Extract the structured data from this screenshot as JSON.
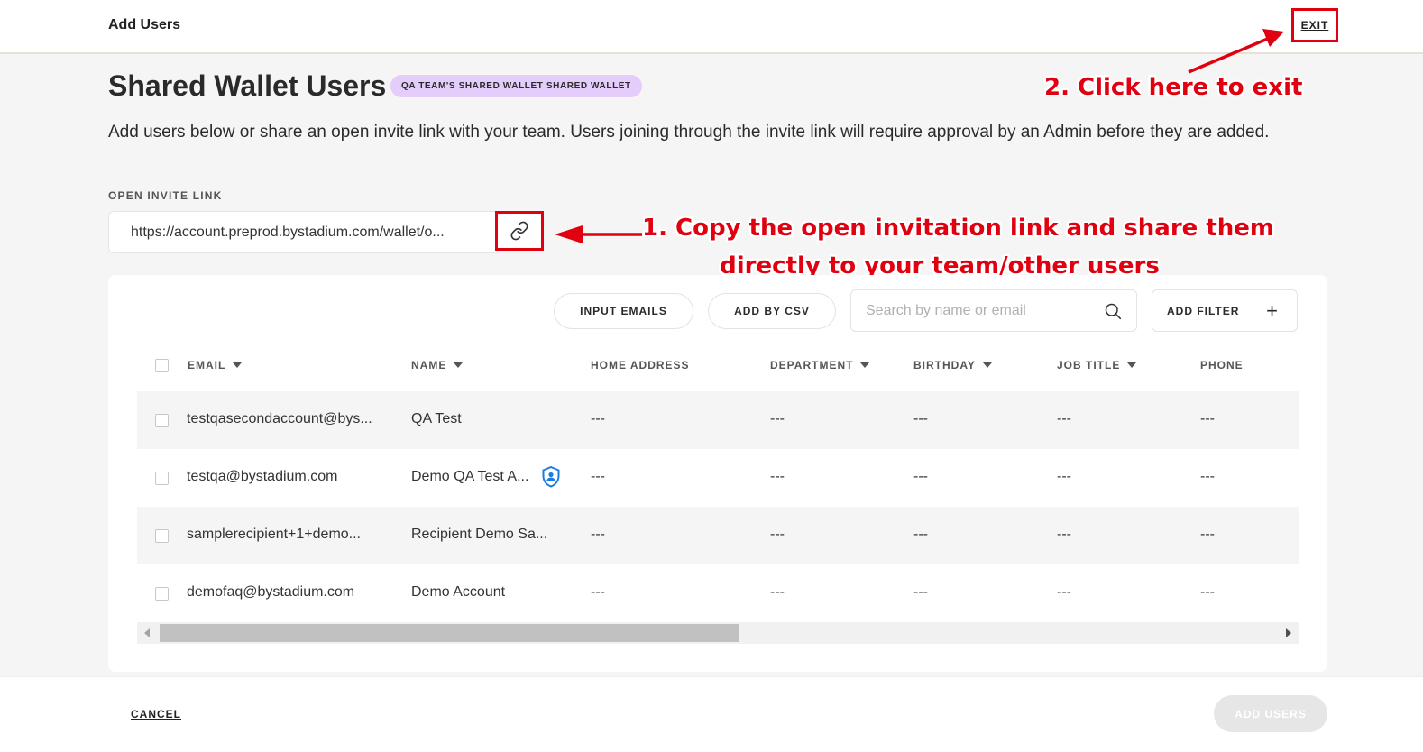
{
  "header": {
    "title": "Add Users",
    "exit_label": "EXIT"
  },
  "page": {
    "title": "Shared Wallet Users",
    "wallet_badge": "QA TEAM'S SHARED WALLET SHARED WALLET",
    "description": "Add users below or share an open invite link with your team. Users joining through the invite link will require approval by an Admin before they are added."
  },
  "invite": {
    "label": "OPEN INVITE LINK",
    "url": "https://account.preprod.bystadium.com/wallet/o..."
  },
  "annotations": {
    "step1_line1": "1. Copy the open invitation link and share them",
    "step1_line2": "directly to your team/other users",
    "step2": "2. Click here to exit",
    "accent_color": "#e00010"
  },
  "toolbar": {
    "input_emails": "INPUT EMAILS",
    "add_by_csv": "ADD BY CSV",
    "search_placeholder": "Search by name or email",
    "add_filter": "ADD FILTER"
  },
  "table": {
    "columns": [
      "EMAIL",
      "NAME",
      "HOME ADDRESS",
      "DEPARTMENT",
      "BIRTHDAY",
      "JOB TITLE",
      "PHONE"
    ],
    "rows": [
      {
        "email": "testqasecondaccount@bys...",
        "name": "QA Test",
        "home_address": "---",
        "department": "---",
        "birthday": "---",
        "job_title": "---",
        "phone": "---"
      },
      {
        "email": "testqa@bystadium.com",
        "name": "Demo QA Test A...",
        "home_address": "---",
        "department": "---",
        "birthday": "---",
        "job_title": "---",
        "phone": "---"
      },
      {
        "email": "samplerecipient+1+demo...",
        "name": "Recipient Demo Sa...",
        "home_address": "---",
        "department": "---",
        "birthday": "---",
        "job_title": "---",
        "phone": "---"
      },
      {
        "email": "demofaq@bystadium.com",
        "name": "Demo Account",
        "home_address": "---",
        "department": "---",
        "birthday": "---",
        "job_title": "---",
        "phone": "---"
      }
    ]
  },
  "footer": {
    "cancel_label": "CANCEL",
    "add_users_label": "ADD USERS"
  }
}
